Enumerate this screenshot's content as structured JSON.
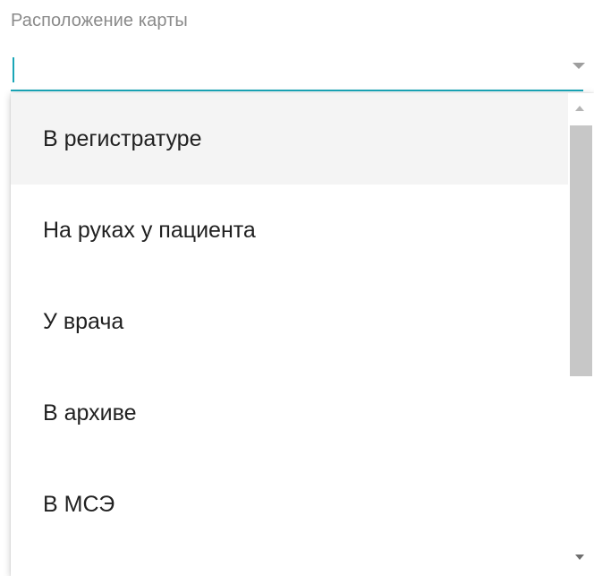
{
  "field": {
    "label": "Расположение карты",
    "value": "",
    "placeholder": ""
  },
  "menu": {
    "items": [
      {
        "label": "В регистратуре"
      },
      {
        "label": "На руках у пациента"
      },
      {
        "label": "У врача"
      },
      {
        "label": "В архиве"
      },
      {
        "label": "В МСЭ"
      }
    ],
    "highlighted_index": 0
  },
  "colors": {
    "accent": "#1aa6b7",
    "label": "#8a8a8a",
    "highlight_bg": "#f4f4f4"
  },
  "icons": {
    "dropdown": "chevron-down-icon",
    "scroll_up": "scroll-up-arrow-icon",
    "scroll_down": "scroll-down-arrow-icon"
  }
}
